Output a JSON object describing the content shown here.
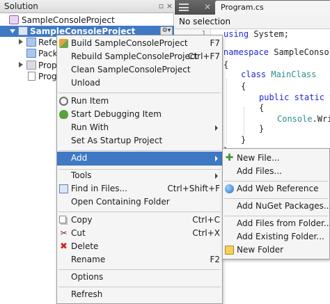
{
  "solution_pad": {
    "title": "Solution",
    "dock_icon": "dock-icon",
    "close_icon": "close-icon",
    "tree": {
      "solution_label": "SampleConsoleProject",
      "project_label": "SampleConsoleProject",
      "gear_icon": "gear-icon",
      "children": [
        "Refere",
        "Packa",
        "Prope",
        "Progr"
      ]
    }
  },
  "editor": {
    "tab_label": "Program.cs",
    "nav_bar_text": "No selection",
    "line_number_visible": "1",
    "code": {
      "l1_kw": "using",
      "l1_rest": " System;",
      "l2_kw": "namespace",
      "l2_rest": " SampleConsole",
      "l3": "{",
      "l4_kw": "class",
      "l4_type": " MainClass",
      "l5": "{",
      "l6_kw": "public static",
      "l6_rest": " v",
      "l7": "{",
      "l8_type": "Console",
      "l8_rest": ".Wri",
      "l9": "}",
      "l10": "}",
      "l11": "}"
    }
  },
  "context_menu": {
    "items": [
      {
        "label": "Build SampleConsoleProject",
        "shortcut": "F7",
        "icon": "build-icon"
      },
      {
        "label": "Rebuild SampleConsoleProject",
        "shortcut": "Ctrl+F7"
      },
      {
        "label": "Clean SampleConsoleProject",
        "shortcut": ""
      },
      {
        "label": "Unload",
        "shortcut": ""
      },
      {
        "label": "Run Item",
        "shortcut": "",
        "icon": "run-icon"
      },
      {
        "label": "Start Debugging Item",
        "shortcut": "",
        "icon": "debug-icon"
      },
      {
        "label": "Run With",
        "shortcut": ""
      },
      {
        "label": "Set As Startup Project",
        "shortcut": ""
      },
      {
        "label": "Add",
        "shortcut": ""
      },
      {
        "label": "Tools",
        "shortcut": ""
      },
      {
        "label": "Find in Files...",
        "shortcut": "Ctrl+Shift+F",
        "icon": "find-icon"
      },
      {
        "label": "Open Containing Folder",
        "shortcut": ""
      },
      {
        "label": "Copy",
        "shortcut": "Ctrl+C",
        "icon": "copy-icon"
      },
      {
        "label": "Cut",
        "shortcut": "Ctrl+X",
        "icon": "cut-icon"
      },
      {
        "label": "Delete",
        "shortcut": "",
        "icon": "delete-icon"
      },
      {
        "label": "Rename",
        "shortcut": "F2"
      },
      {
        "label": "Options",
        "shortcut": ""
      },
      {
        "label": "Refresh",
        "shortcut": ""
      }
    ]
  },
  "add_submenu": {
    "items": [
      {
        "label": "New File...",
        "icon": "new-file-icon"
      },
      {
        "label": "Add Files..."
      },
      {
        "label": "Add Web Reference",
        "icon": "globe-icon"
      },
      {
        "label": "Add NuGet Packages..."
      },
      {
        "label": "Add Files from Folder..."
      },
      {
        "label": "Add Existing Folder..."
      },
      {
        "label": "New Folder",
        "icon": "new-folder-icon"
      }
    ]
  },
  "colors": {
    "selection": "#3f79c4",
    "keyword": "#1f29d1",
    "type": "#2a8f8f",
    "menu_background": "#f5f5f5"
  }
}
